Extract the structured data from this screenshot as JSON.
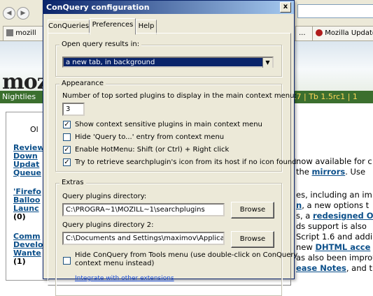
{
  "background_browser": {
    "url_fragment": "",
    "tabs": [
      "mozill",
      "...",
      "Mozilla Update"
    ],
    "logo_text": "moz",
    "greenbar_left": "Nightlies",
    "greenbar_links": ".7 | Tb 1.5rc1 | 1",
    "left_col_heading": "Ol",
    "left_links": [
      "Review",
      "Down",
      "Updat",
      "Queue",
      "'Firefo",
      "Balloo",
      "Launc",
      "(0)",
      "Comm",
      "Develo",
      "Wante",
      "(1)"
    ],
    "right_lines": [
      {
        "text": "now available for c",
        "link": ""
      },
      {
        "text": "the ",
        "link": "mirrors",
        "after": ". Use"
      },
      {
        "text": "es, including an im",
        "link": ""
      },
      {
        "text": "",
        "link": "n",
        "after": ", a new options t"
      },
      {
        "text": "s, a ",
        "link": "redesigned O",
        "after": ""
      },
      {
        "text": "ds support is also",
        "link": ""
      },
      {
        "text": "Script 1.6 and addi",
        "link": ""
      },
      {
        "text": "new ",
        "link": "DHTML acce",
        "after": ""
      },
      {
        "text": "as also been improv",
        "link": ""
      },
      {
        "text": "",
        "link": "ease Notes",
        "after": ", and t"
      }
    ]
  },
  "dialog": {
    "title": "ConQuery configuration",
    "close_label": "x",
    "tabs": [
      "ConQueries",
      "Preferences",
      "Help"
    ],
    "active_tab": "Preferences",
    "open_results": {
      "legend": "Open query results in:",
      "selected": "a new tab, in background"
    },
    "appearance": {
      "legend": "Appearance",
      "plugins_count_label": "Number of top sorted plugins to display in the main context menu:",
      "plugins_count_value": "3",
      "checkboxes": [
        {
          "label": "Show context sensitive plugins in main context menu",
          "checked": true
        },
        {
          "label": "Hide 'Query to...' entry from context menu",
          "checked": false
        },
        {
          "label": "Enable HotMenu: Shift (or Ctrl) + Right click",
          "checked": true
        },
        {
          "label": "Try to retrieve searchplugin's icon from its host if no icon found",
          "checked": true
        }
      ]
    },
    "extras": {
      "legend": "Extras",
      "dir1_label": "Query plugins directory:",
      "dir1_value": "C:\\PROGRA~1\\MOZILL~1\\searchplugins",
      "dir2_label": "Query plugins directory 2:",
      "dir2_value": "C:\\Documents and Settings\\maximov\\Application Dat",
      "browse_label": "Browse",
      "hide_label_line1": "Hide ConQuery from Tools menu (use double-click on ConQuery",
      "hide_label_line2": "context menu instead)",
      "hide_checked": false,
      "integrate_link": "Integrate with other extensions"
    }
  }
}
